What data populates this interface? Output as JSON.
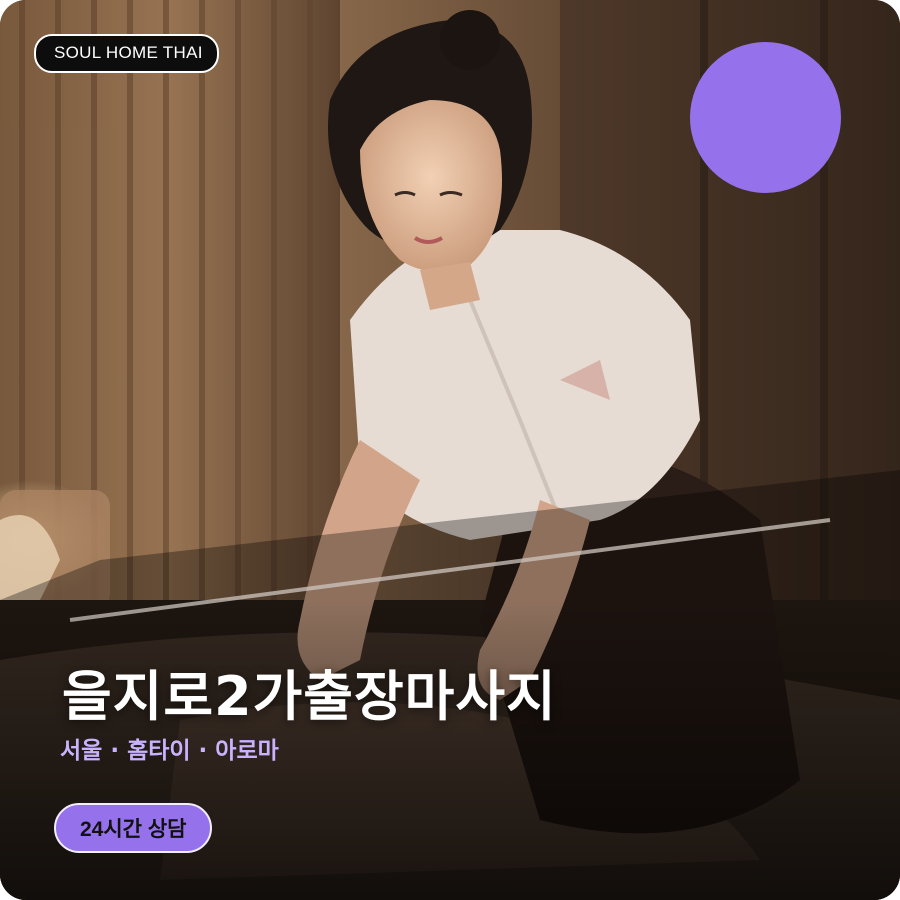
{
  "brand": {
    "badge_text": "SOUL HOME THAI"
  },
  "hero": {
    "title": "을지로2가출장마사지",
    "subtitle": "서울 · 홈타이 · 아로마"
  },
  "cta": {
    "consult_label": "24시간 상담"
  },
  "colors": {
    "accent": "#9572ec",
    "subtitle_text": "#c9b3ff",
    "badge_bg": "#0d0d0d"
  }
}
